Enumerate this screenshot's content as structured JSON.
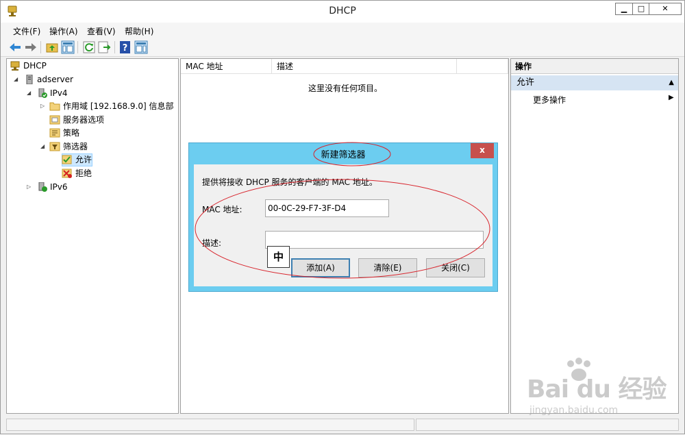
{
  "window": {
    "title": "DHCP",
    "minimize": "▁",
    "maximize": "□",
    "close": "✕"
  },
  "menu": [
    "文件(F)",
    "操作(A)",
    "查看(V)",
    "帮助(H)"
  ],
  "tree": {
    "root": "DHCP",
    "server": "adserver",
    "ipv4": "IPv4",
    "scope": "作用域 [192.168.9.0] 信息部",
    "server_options": "服务器选项",
    "policies": "策略",
    "filters": "筛选器",
    "allow": "允许",
    "deny": "拒绝",
    "ipv6": "IPv6"
  },
  "list": {
    "columns": [
      "MAC 地址",
      "描述"
    ],
    "empty_message": "这里没有任何项目。"
  },
  "actions": {
    "header": "操作",
    "section": "允许",
    "more": "更多操作"
  },
  "dialog": {
    "title": "新建筛选器",
    "close": "x",
    "instruction": "提供将接收 DHCP 服务的客户端的 MAC 地址。",
    "mac_label": "MAC 地址:",
    "mac_value": "00-0C-29-F7-3F-D4",
    "desc_label": "描述:",
    "desc_value": "",
    "add_button": "添加(A)",
    "clear_button": "清除(E)",
    "close_button": "关闭(C)"
  },
  "ime_indicator": "中",
  "watermark": {
    "main": "Bai du 经验",
    "sub": "jingyan.baidu.com"
  },
  "colors": {
    "dialog_frame": "#6ccdf0",
    "close_red": "#c7504d",
    "annotation_red": "#d8242c",
    "selection": "#cde8ff",
    "action_section": "#d6e4f3"
  }
}
